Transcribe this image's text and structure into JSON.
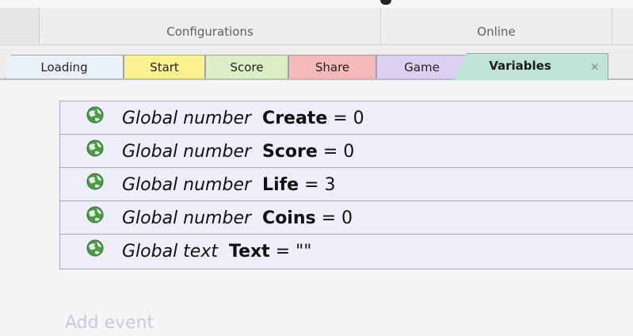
{
  "ribbon": {
    "groups": [
      {
        "label": "Configurations"
      },
      {
        "label": "Online"
      }
    ]
  },
  "tabs": [
    {
      "label": "Loading",
      "color": "#e9f1f7"
    },
    {
      "label": "Start",
      "color": "#fbf18f"
    },
    {
      "label": "Score",
      "color": "#dcefc4"
    },
    {
      "label": "Share",
      "color": "#f6b9b9"
    },
    {
      "label": "Game",
      "color": "#dcd0f0"
    },
    {
      "label": "Variables",
      "color": "#bfe3d8",
      "active": true,
      "close": "×"
    }
  ],
  "events": [
    {
      "icon": "globe-icon",
      "kind": "Global number",
      "name": "Create",
      "value": "= 0"
    },
    {
      "icon": "globe-icon",
      "kind": "Global number",
      "name": "Score",
      "value": "= 0"
    },
    {
      "icon": "globe-icon",
      "kind": "Global number",
      "name": "Life",
      "value": "= 3"
    },
    {
      "icon": "globe-icon",
      "kind": "Global number",
      "name": "Coins",
      "value": "= 0"
    },
    {
      "icon": "globe-icon",
      "kind": "Global text",
      "name": "Text",
      "value": "= \"\""
    }
  ],
  "add_event": "Add event",
  "colors": {
    "event_row_bg": "#eeeefb",
    "event_border": "#a9a6d6",
    "add_event_text": "#c9c6ea"
  }
}
